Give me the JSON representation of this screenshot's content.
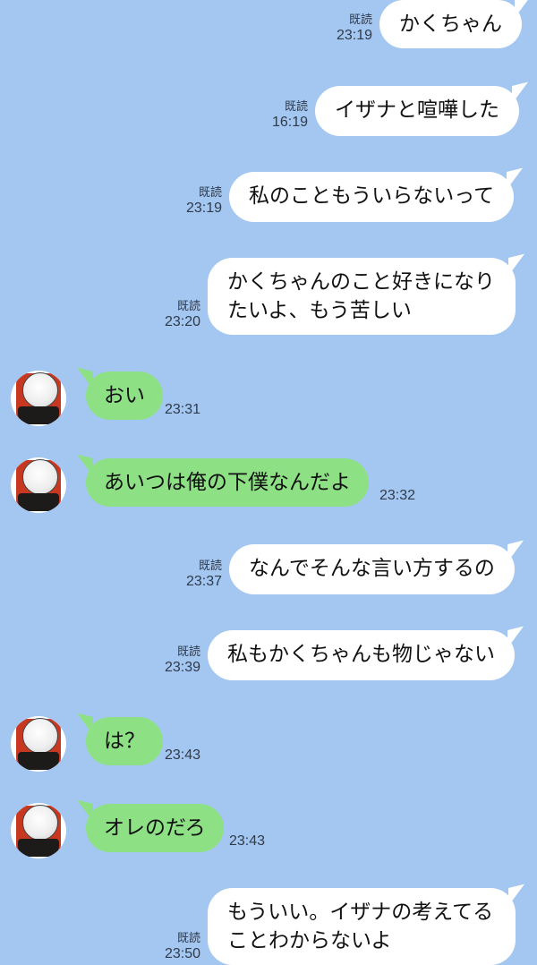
{
  "chat": {
    "messages": [
      {
        "side": "out",
        "text": "かくちゃん",
        "read": "既読",
        "time": "23:19"
      },
      {
        "side": "out",
        "text": "イザナと喧嘩した",
        "read": "既読",
        "time": "16:19"
      },
      {
        "side": "out",
        "text": "私のこともういらないって",
        "read": "既読",
        "time": "23:19"
      },
      {
        "side": "out",
        "text_line1": "かくちゃんのこと好きになり",
        "text_line2": "たいよ、もう苦しい",
        "read": "既読",
        "time": "23:20"
      },
      {
        "side": "in",
        "text": "おい",
        "time": "23:31"
      },
      {
        "side": "in",
        "text": "あいつは俺の下僕なんだよ",
        "time": "23:32"
      },
      {
        "side": "out",
        "text": "なんでそんな言い方するの",
        "read": "既読",
        "time": "23:37"
      },
      {
        "side": "out",
        "text": "私もかくちゃんも物じゃない",
        "read": "既読",
        "time": "23:39"
      },
      {
        "side": "in",
        "text": "は？",
        "time": "23:43"
      },
      {
        "side": "in",
        "text": "オレのだろ",
        "time": "23:43"
      },
      {
        "side": "out",
        "text_line1": "もういい。イザナの考えてる",
        "text_line2": "ことわからないよ",
        "read": "既読",
        "time": "23:50"
      }
    ]
  },
  "colors": {
    "background": "#a4c7f2",
    "outgoing_bubble": "#ffffff",
    "incoming_bubble": "#8ee085",
    "meta_text": "#2f3a4a"
  },
  "icons": {
    "avatar": "contact-avatar-icon"
  }
}
